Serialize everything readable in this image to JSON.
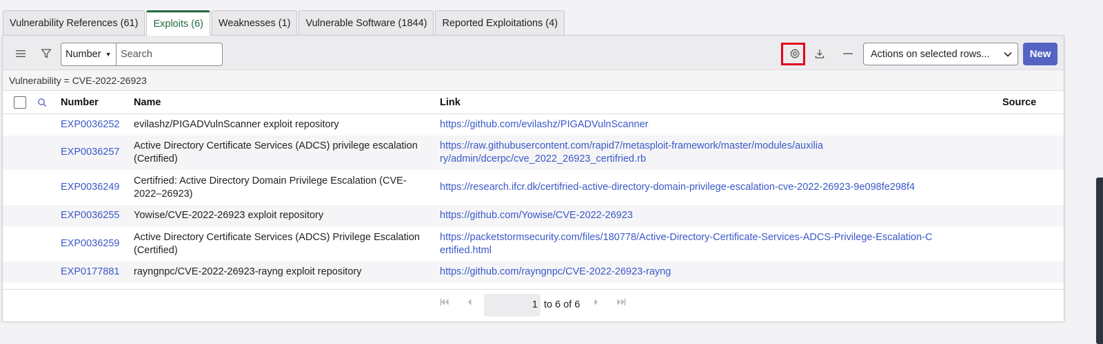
{
  "tabs": [
    {
      "label": "Vulnerability References (61)",
      "active": false
    },
    {
      "label": "Exploits (6)",
      "active": true
    },
    {
      "label": "Weaknesses (1)",
      "active": false
    },
    {
      "label": "Vulnerable Software (1844)",
      "active": false
    },
    {
      "label": "Reported Exploitations (4)",
      "active": false
    }
  ],
  "toolbar": {
    "field_select": "Number",
    "search_placeholder": "Search",
    "actions_label": "Actions on selected rows...",
    "new_label": "New"
  },
  "filter": "Vulnerability = CVE-2022-26923",
  "columns": [
    "Number",
    "Name",
    "Link",
    "Source"
  ],
  "rows": [
    {
      "number": "EXP0036252",
      "name": "evilashz/PIGADVulnScanner exploit repository",
      "link": "https://github.com/evilashz/PIGADVulnScanner"
    },
    {
      "number": "EXP0036257",
      "name": "Active Directory Certificate Services (ADCS) privilege escalation (Certified)",
      "link": "https://raw.githubusercontent.com/rapid7/metasploit-framework/master/modules/auxiliary/admin/dcerpc/cve_2022_26923_certifried.rb"
    },
    {
      "number": "EXP0036249",
      "name": "Certifried: Active Directory Domain Privilege Escalation (CVE-2022–26923)",
      "link": "https://research.ifcr.dk/certifried-active-directory-domain-privilege-escalation-cve-2022-26923-9e098fe298f4"
    },
    {
      "number": "EXP0036255",
      "name": "Yowise/CVE-2022-26923 exploit repository",
      "link": "https://github.com/Yowise/CVE-2022-26923"
    },
    {
      "number": "EXP0036259",
      "name": "Active Directory Certificate Services (ADCS) Privilege Escalation (Certified)",
      "link": "https://packetstormsecurity.com/files/180778/Active-Directory-Certificate-Services-ADCS-Privilege-Escalation-Certified.html"
    },
    {
      "number": "EXP0177881",
      "name": "rayngnpc/CVE-2022-26923-rayng exploit repository",
      "link": "https://github.com/rayngnpc/CVE-2022-26923-rayng"
    }
  ],
  "pagination": {
    "current": "1",
    "range": "to 6 of 6"
  },
  "icons": [
    "menu-icon",
    "filter-icon",
    "gear-icon",
    "download-icon",
    "collapse-icon",
    "first-page-icon",
    "prev-page-icon",
    "next-page-icon",
    "last-page-icon",
    "search-icon"
  ],
  "colors": {
    "accent": "#1f6a3f",
    "link": "#3a58c8",
    "new_button": "#5563c5",
    "highlight": "#e0001b"
  }
}
